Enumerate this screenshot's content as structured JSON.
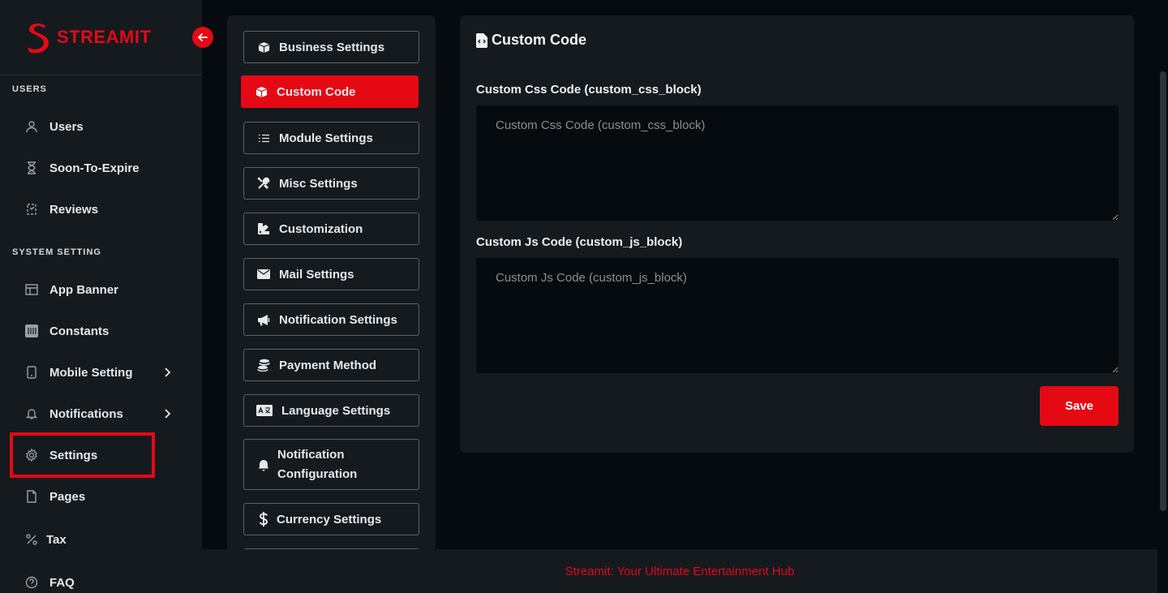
{
  "brand": {
    "name": "STREAMIT",
    "accent": "#e50914"
  },
  "sidebar": {
    "sections": [
      {
        "label": "USERS"
      },
      {
        "label": "SYSTEM SETTING"
      }
    ],
    "items": [
      {
        "label": "Users",
        "icon": "user-icon"
      },
      {
        "label": "Soon-To-Expire",
        "icon": "hourglass-icon"
      },
      {
        "label": "Reviews",
        "icon": "review-icon"
      },
      {
        "label": "App Banner",
        "icon": "banner-icon"
      },
      {
        "label": "Constants",
        "icon": "constants-icon"
      },
      {
        "label": "Mobile Setting",
        "icon": "mobile-icon"
      },
      {
        "label": "Notifications",
        "icon": "bell-icon"
      },
      {
        "label": "Settings",
        "icon": "gear-icon",
        "highlighted": true
      },
      {
        "label": "Pages",
        "icon": "page-icon"
      },
      {
        "label": "Tax",
        "icon": "percent-icon"
      },
      {
        "label": "FAQ",
        "icon": "question-icon"
      }
    ]
  },
  "settings_menu": {
    "items": [
      {
        "label": "Business Settings",
        "icon": "box-icon"
      },
      {
        "label": "Custom Code",
        "icon": "box-icon",
        "active": true
      },
      {
        "label": "Module Settings",
        "icon": "list-icon"
      },
      {
        "label": "Misc Settings",
        "icon": "tools-icon"
      },
      {
        "label": "Customization",
        "icon": "palette-icon"
      },
      {
        "label": "Mail Settings",
        "icon": "envelope-icon"
      },
      {
        "label": "Notification Settings",
        "icon": "megaphone-icon"
      },
      {
        "label": "Payment Method",
        "icon": "coins-icon"
      },
      {
        "label": "Language Settings",
        "icon": "language-icon"
      },
      {
        "label": "Notification Configuration",
        "label_line1": "Notification",
        "label_line2": "Configuration",
        "icon": "bell-icon"
      },
      {
        "label": "Currency Settings",
        "icon": "dollar-icon"
      }
    ]
  },
  "main": {
    "title": "Custom Code",
    "css_field": {
      "label": "Custom Css Code (custom_css_block)",
      "placeholder": "Custom Css Code (custom_css_block)",
      "value": ""
    },
    "js_field": {
      "label": "Custom Js Code (custom_js_block)",
      "placeholder": "Custom Js Code (custom_js_block)",
      "value": ""
    },
    "save_label": "Save"
  },
  "footer": {
    "text": "Streamit: Your Ultimate Entertainment Hub"
  }
}
